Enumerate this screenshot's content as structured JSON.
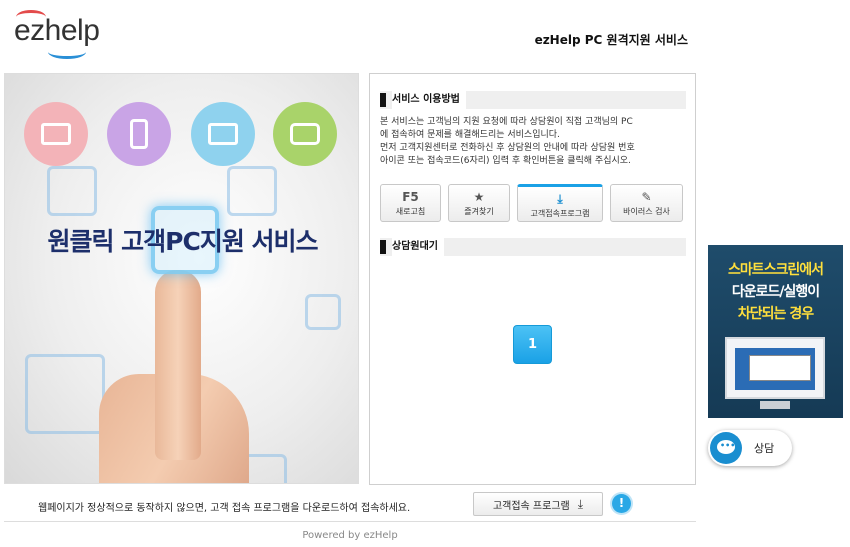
{
  "header": {
    "logo": "ezhelp",
    "title": "ezHelp PC 원격지원 서비스"
  },
  "hero": {
    "headline": "원클릭 고객PC지원 서비스",
    "icons": [
      "laptop-icon",
      "mobile-icon",
      "monitor-icon",
      "tablet-icon"
    ]
  },
  "panel": {
    "usage_title": "서비스 이용방법",
    "desc_lines": [
      "본 서비스는 고객님의 지원 요청에 따라 상담원이 직접 고객님의 PC",
      "에 접속하여 문제를 해결해드리는 서비스입니다.",
      "먼저 고객지원센터로 전화하신 후 상담원의 안내에 따라 상담원 번호",
      "아이콘 또는 접속코드(6자리) 입력 후 확인버튼을 클릭해 주십시오."
    ],
    "tools": [
      {
        "glyph": "F5",
        "label": "새로고침"
      },
      {
        "glyph": "★",
        "label": "즐겨찾기"
      },
      {
        "glyph": "⤓",
        "label": "고객접속프로그램"
      },
      {
        "glyph": "✎",
        "label": "바이러스 검사"
      }
    ],
    "waiting_title": "상담원대기",
    "agent_number": "1"
  },
  "banner": {
    "line1": "스마트스크린에서",
    "line2": "다운로드/실행이",
    "line3": "차단되는 경우"
  },
  "chat": {
    "label": "상담",
    "dots": "•••"
  },
  "footer": {
    "notice": "웹페이지가 정상적으로 동작하지 않으면, 고객 접속 프로그램을 다운로드하여 접속하세요.",
    "download_label": "고객접속 프로그램",
    "download_glyph": "⤓",
    "info_glyph": "!",
    "powered": "Powered by ezHelp"
  },
  "colors": {
    "accent": "#1aa1e6",
    "banner_bg": "#1f4c6b",
    "banner_highlight": "#ffdf3c"
  }
}
